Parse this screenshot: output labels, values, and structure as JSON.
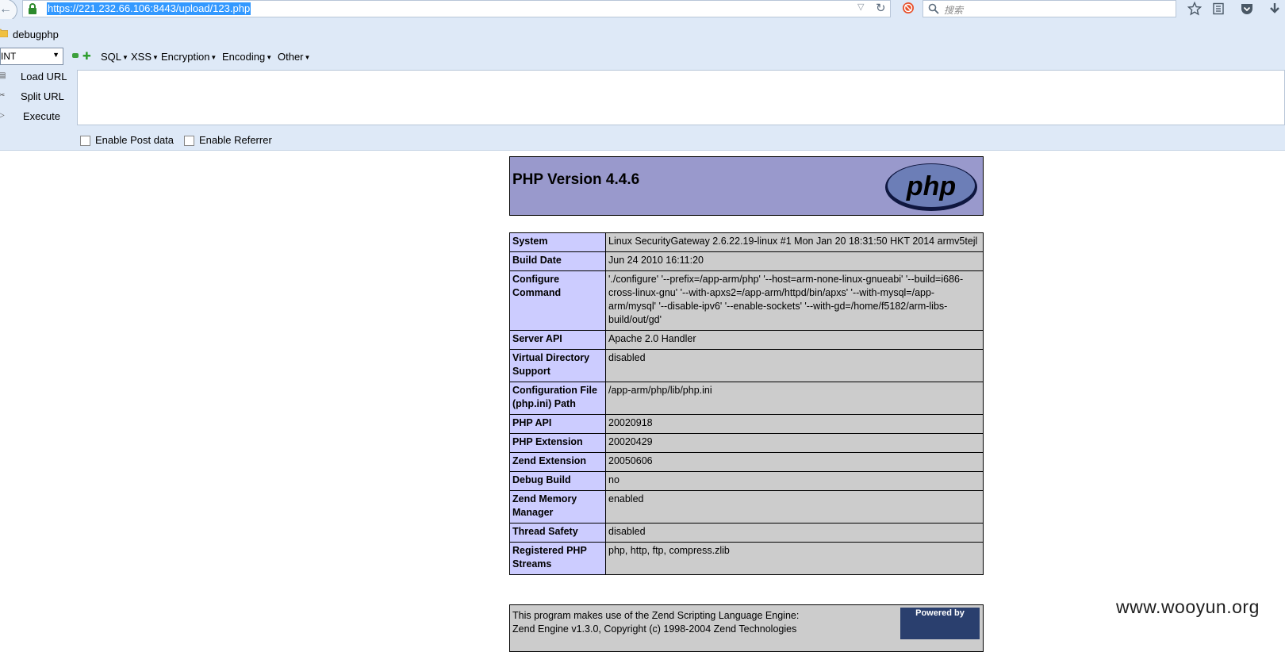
{
  "browser": {
    "url": "https://221.232.66.106:8443/upload/123.php",
    "search_placeholder": "搜索"
  },
  "bookmarks": {
    "folder_label": "debugphp"
  },
  "hackbar": {
    "select_value": "INT",
    "menus": [
      "SQL",
      "XSS",
      "Encryption",
      "Encoding",
      "Other"
    ],
    "load_url": "Load URL",
    "split_url": "Split URL",
    "execute": "Execute",
    "enable_post": "Enable Post data",
    "enable_referrer": "Enable Referrer"
  },
  "phpinfo": {
    "title": "PHP Version 4.4.6",
    "logo_text": "php",
    "rows": [
      {
        "label": "System",
        "value": "Linux SecurityGateway 2.6.22.19-linux #1 Mon Jan 20 18:31:50 HKT 2014 armv5tejl"
      },
      {
        "label": "Build Date",
        "value": "Jun 24 2010 16:11:20"
      },
      {
        "label": "Configure Command",
        "value": "'./configure' '--prefix=/app-arm/php' '--host=arm-none-linux-gnueabi' '--build=i686-cross-linux-gnu' '--with-apxs2=/app-arm/httpd/bin/apxs' '--with-mysql=/app-arm/mysql' '--disable-ipv6' '--enable-sockets' '--with-gd=/home/f5182/arm-libs-build/out/gd'"
      },
      {
        "label": "Server API",
        "value": "Apache 2.0 Handler"
      },
      {
        "label": "Virtual Directory Support",
        "value": "disabled"
      },
      {
        "label": "Configuration File (php.ini) Path",
        "value": "/app-arm/php/lib/php.ini"
      },
      {
        "label": "PHP API",
        "value": "20020918"
      },
      {
        "label": "PHP Extension",
        "value": "20020429"
      },
      {
        "label": "Zend Extension",
        "value": "20050606"
      },
      {
        "label": "Debug Build",
        "value": "no"
      },
      {
        "label": "Zend Memory Manager",
        "value": "enabled"
      },
      {
        "label": "Thread Safety",
        "value": "disabled"
      },
      {
        "label": "Registered PHP Streams",
        "value": "php, http, ftp, compress.zlib"
      }
    ],
    "zend_line1": "This program makes use of the Zend Scripting Language Engine:",
    "zend_line2": "Zend Engine v1.3.0, Copyright (c) 1998-2004 Zend Technologies",
    "zend_logo_text": "Powered by"
  },
  "watermark": "www.wooyun.org"
}
